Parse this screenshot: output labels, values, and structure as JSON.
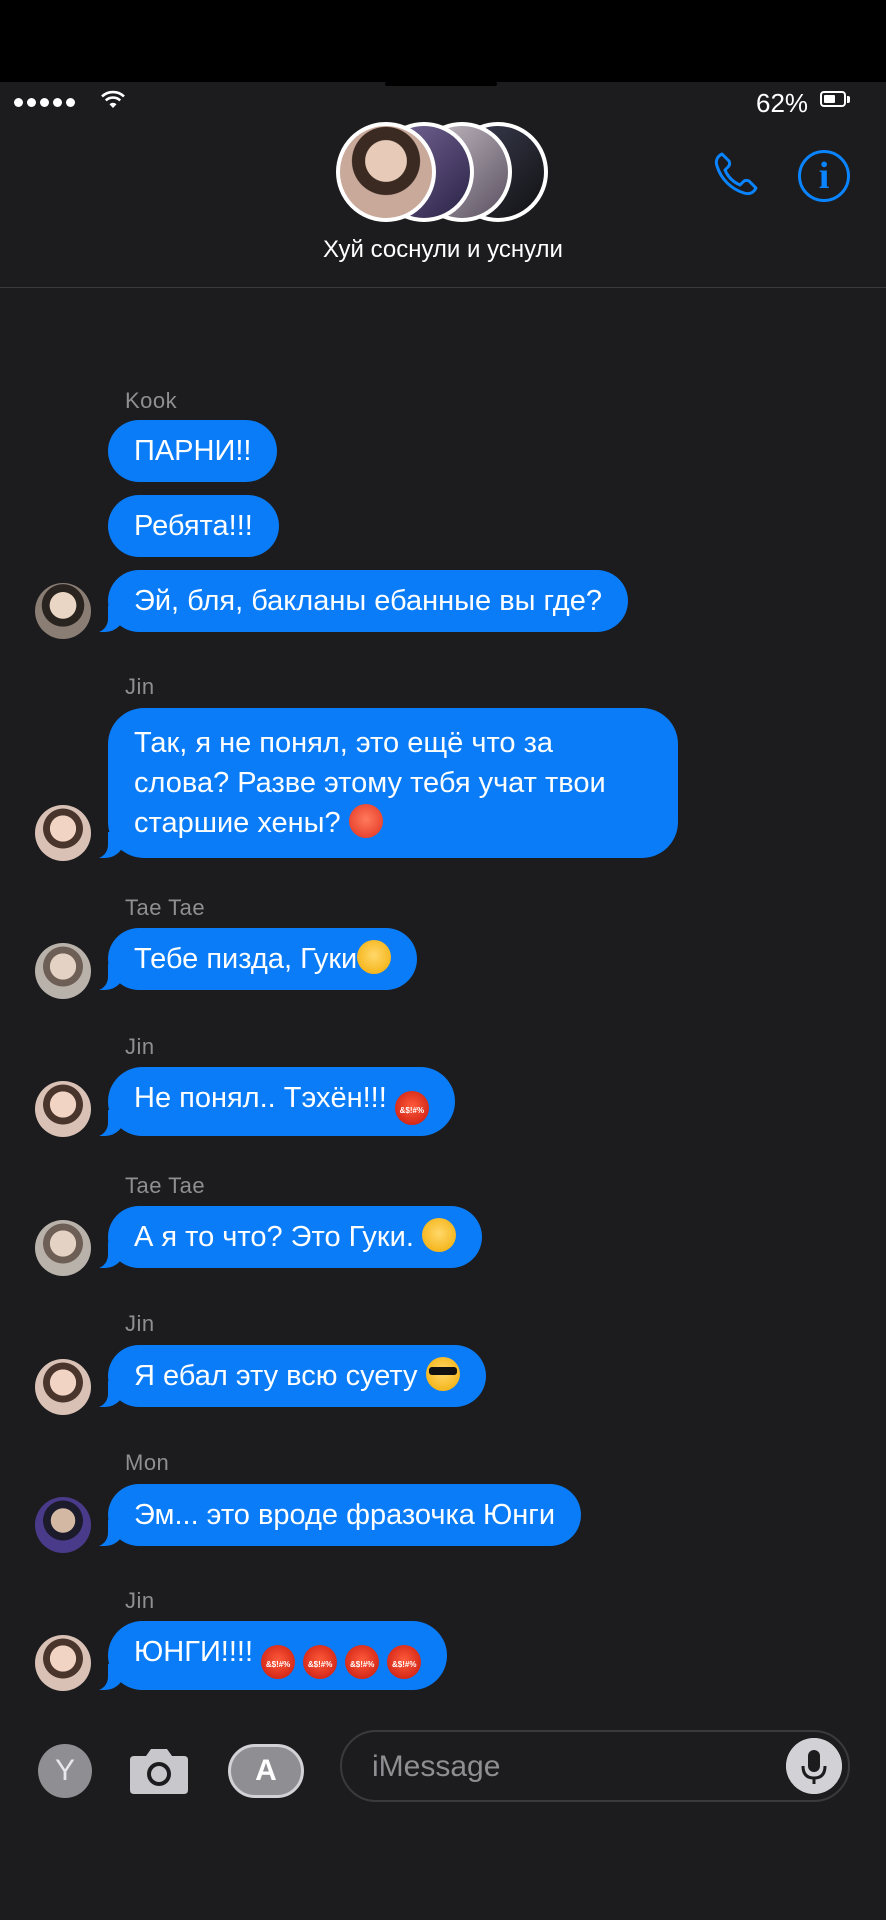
{
  "status": {
    "battery": "62%"
  },
  "header": {
    "title": "Хуй соснули и уснули"
  },
  "messages": [
    {
      "sender": "Kook",
      "bubbles": [
        "ПАРНИ!!",
        "Ребята!!!",
        "Эй, бля, бакланы ебанные вы где?"
      ]
    },
    {
      "sender": "Jin",
      "text": "Так, я не понял, это ещё что за слова? Разве этому тебя учат твои старшие хены?"
    },
    {
      "sender": "Tae Tae",
      "text": "Тебе пизда, Гуки"
    },
    {
      "sender": "Jin",
      "text": "Не понял.. Тэхён!!! "
    },
    {
      "sender": "Tae Tae",
      "text": "А я то что? Это Гуки. "
    },
    {
      "sender": "Jin",
      "text": "Я ебал эту всю суету "
    },
    {
      "sender": "Mon",
      "text": "Эм... это вроде фразочка Юнги"
    },
    {
      "sender": "Jin",
      "text": "ЮНГИ!!!! "
    }
  ],
  "emoji_cursing": "&$!#%",
  "input": {
    "placeholder": "iMessage",
    "y_label": "Y"
  },
  "icons": [
    "phone-icon",
    "info-icon",
    "camera-icon",
    "app-store-icon",
    "mic-icon"
  ],
  "colors": {
    "bubble": "#0a7cf8",
    "accent": "#0a84ff",
    "background": "#1c1c1e"
  }
}
